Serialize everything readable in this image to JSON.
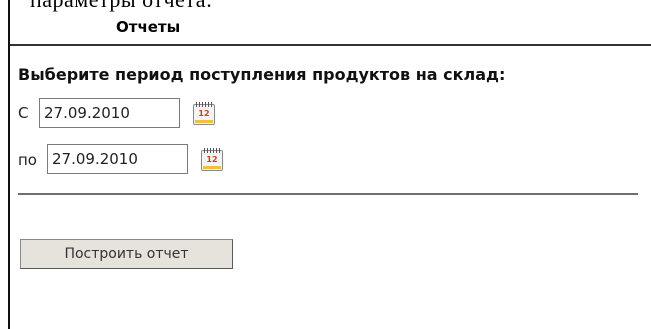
{
  "top_cut_text": "параметры отчета:",
  "panel": {
    "title": "Отчеты"
  },
  "form": {
    "prompt": "Выберите период поступления продуктов на склад:",
    "from_label": "С",
    "from_value": "27.09.2010",
    "to_label": "по",
    "to_value": "27.09.2010",
    "calendar_icon_number": "12",
    "submit_label": "Построить отчет"
  },
  "icons": {
    "from_calendar": "calendar-icon",
    "to_calendar": "calendar-icon"
  }
}
